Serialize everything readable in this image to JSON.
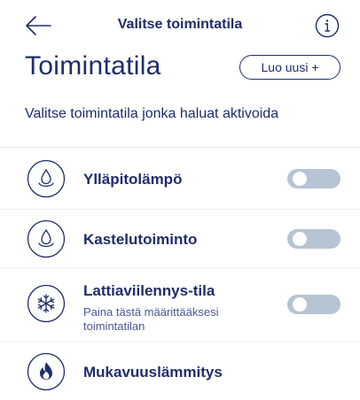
{
  "header": {
    "back_icon": "arrow-left-icon",
    "title": "Valitse toimintatila",
    "info_icon": "info-icon"
  },
  "page": {
    "title": "Toimintatila",
    "new_button_label": "Luo uusi +",
    "subtitle": "Valitse toimintatila jonka haluat aktivoida"
  },
  "modes": [
    {
      "name": "Ylläpitolämpö",
      "icon": "water-drop-icon",
      "enabled": false
    },
    {
      "name": "Kastelutoiminto",
      "icon": "water-drop-icon",
      "enabled": false
    },
    {
      "name": "Lattiaviilennys-tila",
      "description": "Paina tästä määrittääksesi toimintatilan",
      "icon": "snowflake-icon",
      "enabled": false
    },
    {
      "name": "Mukavuuslämmitys",
      "icon": "flame-icon"
    }
  ],
  "colors": {
    "primary": "#1f2d6b",
    "toggle_off": "#b6c4d3",
    "divider": "#eef0f4"
  }
}
